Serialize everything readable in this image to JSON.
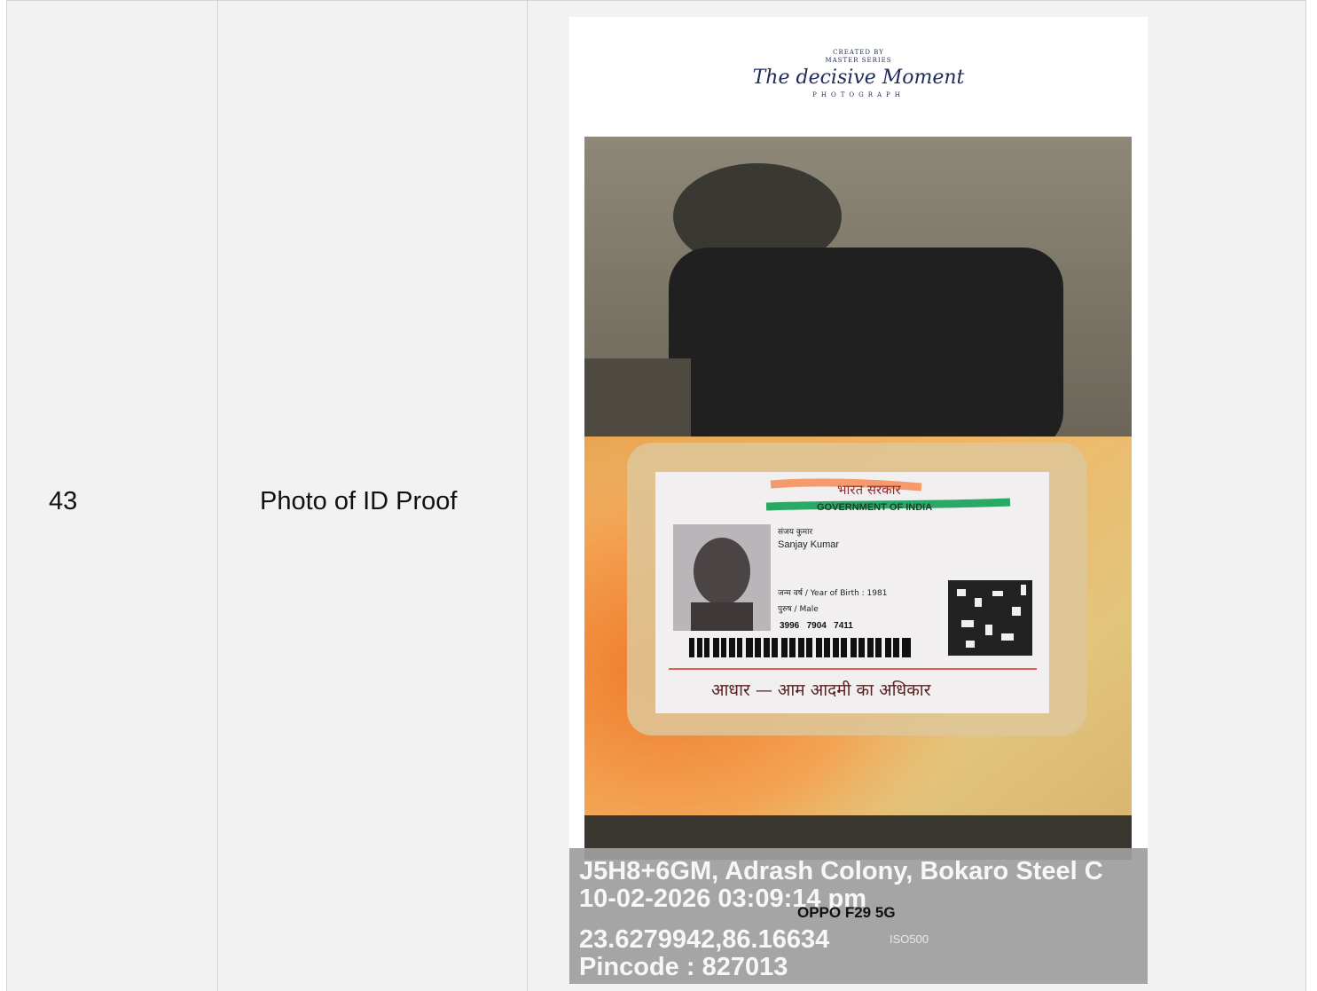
{
  "row": {
    "number": "43",
    "label": "Photo of ID Proof"
  },
  "watermark": {
    "line1": "CREATED BY",
    "line2": "MASTER SERIES",
    "script": "The decisive Moment",
    "bottom": "PHOTOGRAPH"
  },
  "id_card": {
    "header_hindi": "भारत सरकार",
    "header_english": "GOVERNMENT OF INDIA",
    "name_hindi": "संजय कुमार",
    "name_english": "Sanjay Kumar",
    "year_of_birth": "जन्म वर्ष / Year of Birth : 1981",
    "gender": "पुरुष / Male",
    "number": "3996   7904   7411",
    "footer": "आधार — आम आदमी का अधिकार"
  },
  "geotag": {
    "address": "J5H8+6GM, Adrash Colony, Bokaro Steel C",
    "datetime": "10-02-2026 03:09:14 pm",
    "coordinates": "23.6279942,86.16634",
    "pincode": "Pincode : 827013",
    "camera_model": "OPPO F29 5G",
    "camera_settings": "ISO500"
  },
  "colors": {
    "table_bg": "#f2f2f2",
    "border": "#d5d5d5",
    "overlay": "#9e9e9e"
  }
}
